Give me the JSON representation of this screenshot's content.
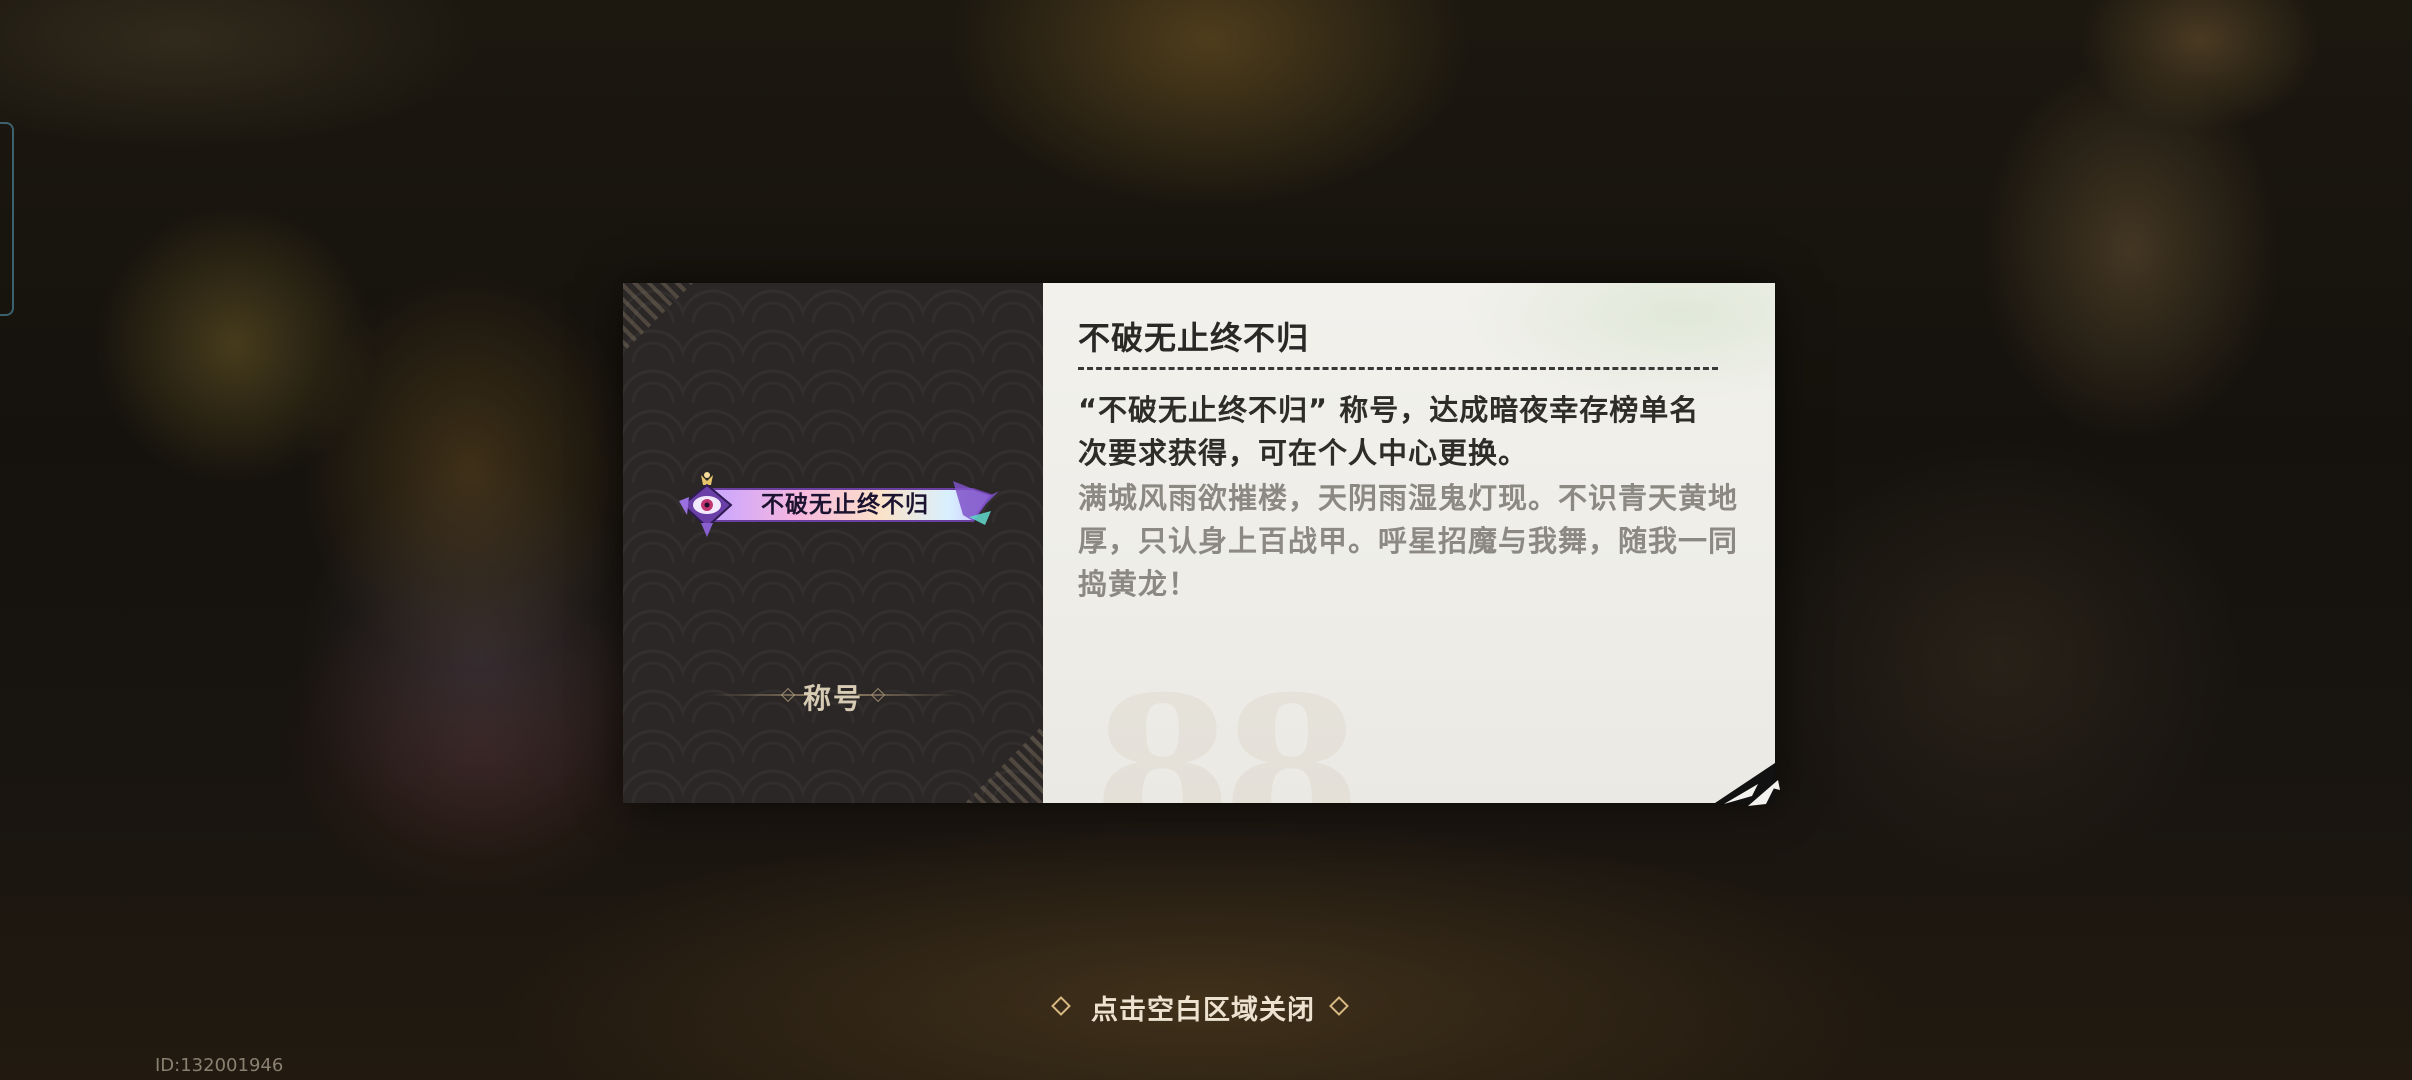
{
  "dialog": {
    "badge_text": "不破无止终不归",
    "category": "称号",
    "title": "不破无止终不归",
    "description": "“不破无止终不归” 称号，达成暗夜幸存榜单名次要求获得，可在个人中心更换。",
    "lore": "满城风雨欲摧楼，天阴雨湿鬼灯现。不识青天黄地厚，只认身上百战甲。呼星招魔与我舞，随我一同捣黄龙！"
  },
  "footer": {
    "close_hint": "点击空白区域关闭",
    "uid": "ID:132001946"
  },
  "colors": {
    "card_left_bg": "#2a2726",
    "card_right_bg": "#f2f1ec",
    "hint_accent": "#d8b982"
  },
  "icons": {
    "badge_emblem": "crowned-eye-emblem-icon",
    "hint_left": "diamond-icon",
    "hint_right": "diamond-icon",
    "corner": "fold-arrow-icon"
  }
}
